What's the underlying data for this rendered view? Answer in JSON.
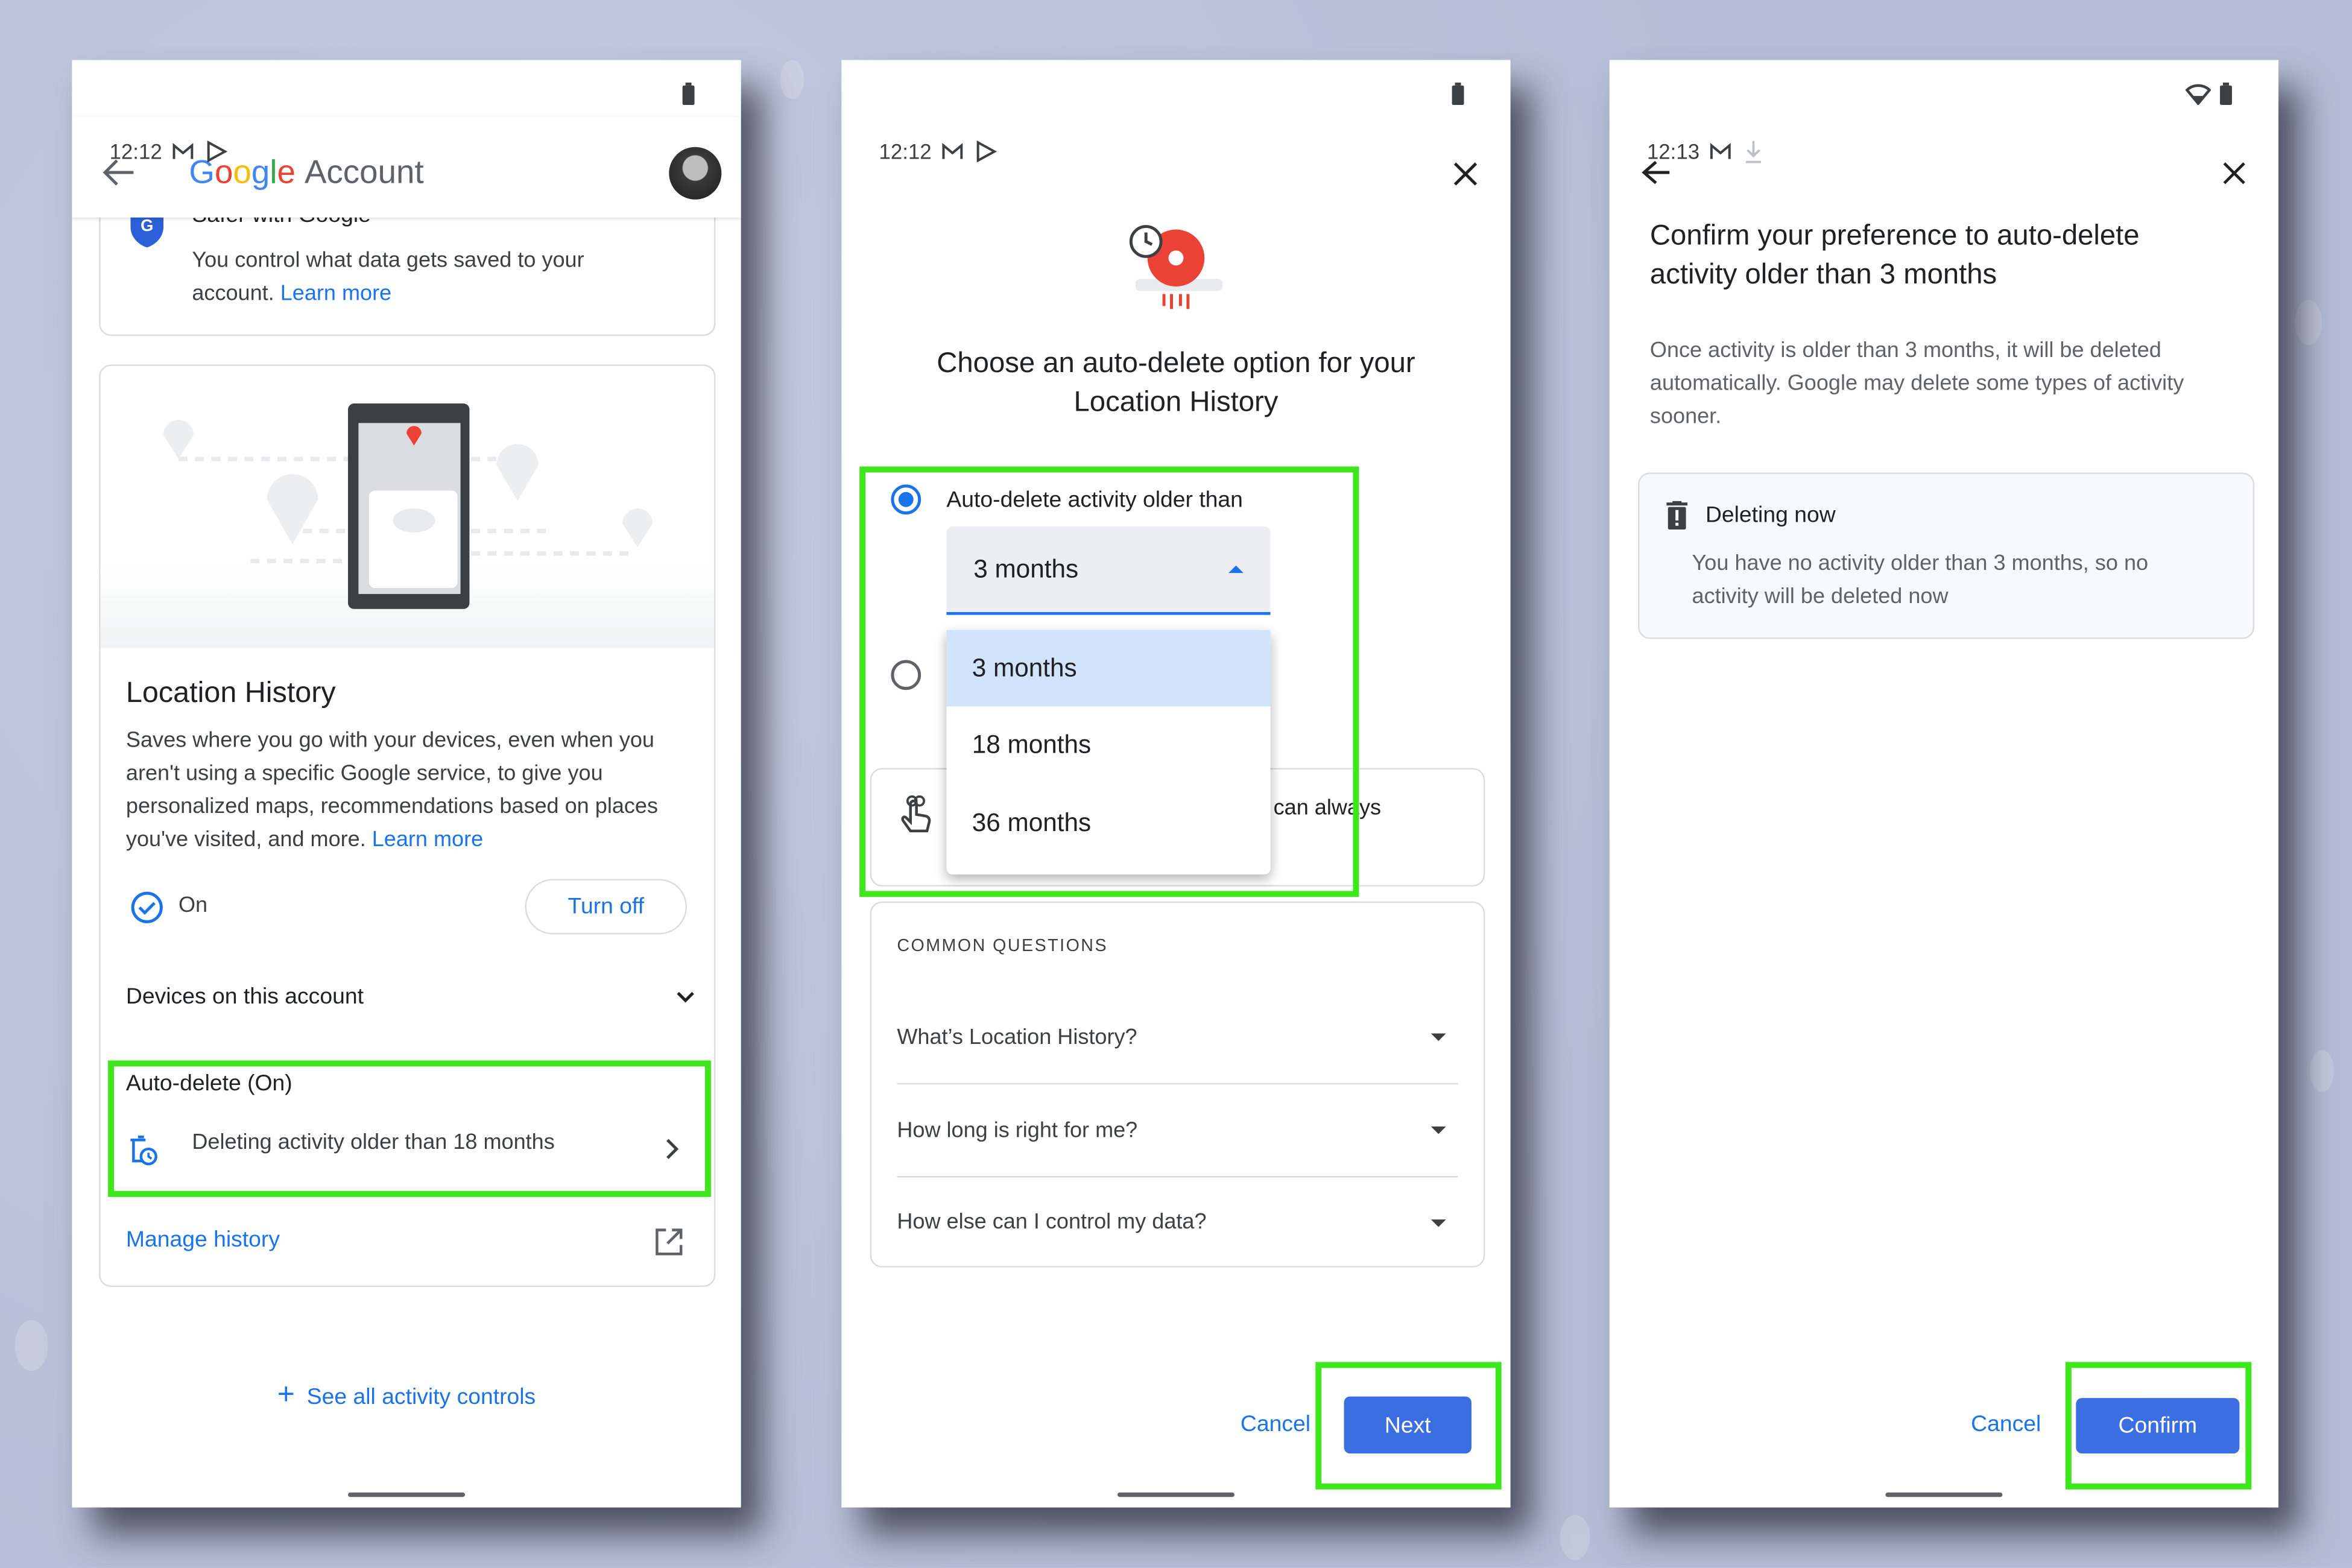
{
  "colors": {
    "accent": "#1a73e8",
    "button": "#3b6ee0",
    "highlight": "#3ee61c",
    "background": "#b9c0d9"
  },
  "screen1": {
    "status": {
      "time": "12:12",
      "icons": [
        "gmail-icon",
        "play-store-icon",
        "battery-icon"
      ]
    },
    "header": {
      "brand": "Google",
      "title": "Account"
    },
    "safer_card": {
      "title": "Safer with Google",
      "text": "You control what data gets saved to your account. ",
      "link": "Learn more"
    },
    "location_card": {
      "title": "Location History",
      "text": "Saves where you go with your devices, even when you aren't using a specific Google service, to give you personalized maps, recommendations based on places you've visited, and more. ",
      "link": "Learn more",
      "status": "On",
      "turn_off": "Turn off",
      "devices": "Devices on this account",
      "auto_delete_title": "Auto-delete (On)",
      "auto_delete_text": "Deleting activity older than 18 months",
      "manage": "Manage history"
    },
    "see_all": "See all activity controls"
  },
  "screen2": {
    "status": {
      "time": "12:12"
    },
    "title": "Choose an auto-delete option for your Location History",
    "option1": "Auto-delete activity older than",
    "option1_selected": true,
    "dropdown": {
      "value": "3 months",
      "options": [
        "3 months",
        "18 months",
        "36 months"
      ],
      "highlighted": "3 months"
    },
    "info_partial": "can always",
    "questions": {
      "header": "COMMON QUESTIONS",
      "items": [
        "What’s Location History?",
        "How long is right for me?",
        "How else can I control my data?"
      ]
    },
    "cancel": "Cancel",
    "next": "Next"
  },
  "screen3": {
    "status": {
      "time": "12:13"
    },
    "title": "Confirm your preference to auto-delete activity older than 3 months",
    "body": "Once activity is older than 3 months, it will be deleted automatically. Google may delete some types of activity sooner.",
    "card": {
      "title": "Deleting now",
      "text": "You have no activity older than 3 months, so no activity will be deleted now"
    },
    "cancel": "Cancel",
    "confirm": "Confirm"
  }
}
